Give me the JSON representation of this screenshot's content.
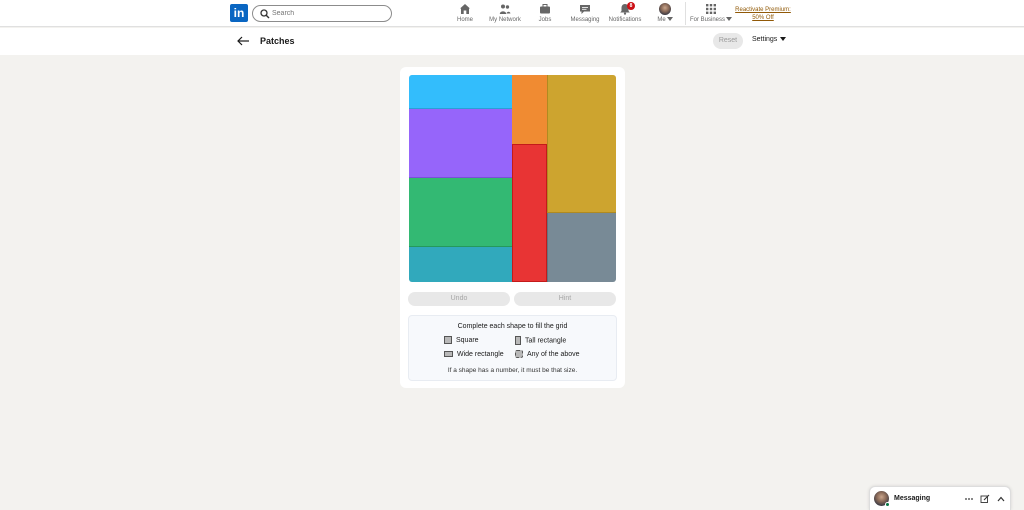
{
  "nav": {
    "logo_text": "in",
    "search_placeholder": "Search",
    "items": [
      {
        "label": "Home",
        "icon": "home-icon"
      },
      {
        "label": "My Network",
        "icon": "network-icon"
      },
      {
        "label": "Jobs",
        "icon": "briefcase-icon"
      },
      {
        "label": "Messaging",
        "icon": "chat-icon"
      },
      {
        "label": "Notifications",
        "icon": "bell-icon",
        "badge": "8"
      },
      {
        "label": "Me",
        "icon": "avatar"
      },
      {
        "label": "For Business",
        "icon": "grid-icon"
      }
    ],
    "premium_line1": "Reactivate Premium:",
    "premium_line2": "50% Off"
  },
  "subheader": {
    "title": "Patches",
    "reset_label": "Reset",
    "settings_label": "Settings"
  },
  "game": {
    "patches": [
      {
        "name": "cyan",
        "color": "#33bdfc"
      },
      {
        "name": "purple",
        "color": "#9665fa"
      },
      {
        "name": "green",
        "color": "#33b973"
      },
      {
        "name": "teal",
        "color": "#31a9bc"
      },
      {
        "name": "orange",
        "color": "#f08b32"
      },
      {
        "name": "red",
        "color": "#e83434"
      },
      {
        "name": "gold",
        "color": "#cda42f"
      },
      {
        "name": "slate",
        "color": "#788a96"
      }
    ],
    "undo_label": "Undo",
    "hint_label": "Hint",
    "legend": {
      "title": "Complete each shape to fill the grid",
      "square": "Square",
      "tall": "Tall rectangle",
      "wide": "Wide rectangle",
      "any": "Any of the above",
      "note": "If a shape has a number, it must be that size."
    }
  },
  "messaging": {
    "label": "Messaging"
  }
}
